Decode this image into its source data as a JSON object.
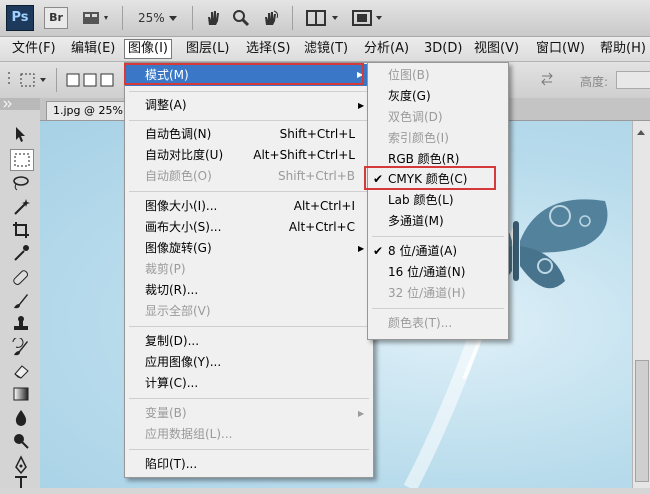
{
  "app": {
    "logo": "Ps",
    "bridge": "Br",
    "zoom": "25%",
    "icons": [
      "ps-logo",
      "bridge-icon",
      "view-extras-icon",
      "hand-icon",
      "zoom-icon",
      "rotate-view-icon",
      "arrange-documents-icon",
      "screen-mode-icon"
    ]
  },
  "menubar": [
    "文件(F)",
    "编辑(E)",
    "图像(I)",
    "图层(L)",
    "选择(S)",
    "滤镜(T)",
    "分析(A)",
    "3D(D)",
    "视图(V)",
    "窗口(W)",
    "帮助(H)"
  ],
  "options": {
    "height_label": "高度:"
  },
  "document": {
    "tab": "1.jpg @ 25%(C"
  },
  "image_menu": {
    "items": [
      {
        "label": "模式(M)",
        "shortcut": "",
        "submenu": true,
        "disabled": false
      },
      {
        "label": "调整(A)",
        "shortcut": "",
        "submenu": true,
        "disabled": false
      },
      {
        "label": "自动色调(N)",
        "shortcut": "Shift+Ctrl+L",
        "disabled": false
      },
      {
        "label": "自动对比度(U)",
        "shortcut": "Alt+Shift+Ctrl+L",
        "disabled": false
      },
      {
        "label": "自动颜色(O)",
        "shortcut": "Shift+Ctrl+B",
        "disabled": true
      },
      {
        "label": "图像大小(I)...",
        "shortcut": "Alt+Ctrl+I",
        "disabled": false
      },
      {
        "label": "画布大小(S)...",
        "shortcut": "Alt+Ctrl+C",
        "disabled": false
      },
      {
        "label": "图像旋转(G)",
        "shortcut": "",
        "submenu": true,
        "disabled": false
      },
      {
        "label": "裁剪(P)",
        "shortcut": "",
        "disabled": true
      },
      {
        "label": "裁切(R)...",
        "shortcut": "",
        "disabled": false
      },
      {
        "label": "显示全部(V)",
        "shortcut": "",
        "disabled": true
      },
      {
        "label": "复制(D)...",
        "shortcut": "",
        "disabled": false
      },
      {
        "label": "应用图像(Y)...",
        "shortcut": "",
        "disabled": false
      },
      {
        "label": "计算(C)...",
        "shortcut": "",
        "disabled": false
      },
      {
        "label": "变量(B)",
        "shortcut": "",
        "submenu": true,
        "disabled": true
      },
      {
        "label": "应用数据组(L)...",
        "shortcut": "",
        "disabled": true
      },
      {
        "label": "陷印(T)...",
        "shortcut": "",
        "disabled": false
      }
    ]
  },
  "mode_submenu": {
    "items": [
      {
        "label": "位图(B)",
        "disabled": true,
        "checked": false
      },
      {
        "label": "灰度(G)",
        "disabled": false,
        "checked": false
      },
      {
        "label": "双色调(D)",
        "disabled": true,
        "checked": false
      },
      {
        "label": "索引颜色(I)",
        "disabled": true,
        "checked": false
      },
      {
        "label": "RGB 颜色(R)",
        "disabled": false,
        "checked": false
      },
      {
        "label": "CMYK 颜色(C)",
        "disabled": false,
        "checked": true
      },
      {
        "label": "Lab 颜色(L)",
        "disabled": false,
        "checked": false
      },
      {
        "label": "多通道(M)",
        "disabled": false,
        "checked": false
      },
      {
        "label": "8 位/通道(A)",
        "disabled": false,
        "checked": true
      },
      {
        "label": "16 位/通道(N)",
        "disabled": false,
        "checked": false
      },
      {
        "label": "32 位/通道(H)",
        "disabled": true,
        "checked": false
      },
      {
        "label": "颜色表(T)...",
        "disabled": true,
        "checked": false
      }
    ]
  },
  "colors": {
    "highlight": "#3a78c7",
    "annotation_box": "#d53a3a",
    "canvas": "#b9dcec"
  }
}
